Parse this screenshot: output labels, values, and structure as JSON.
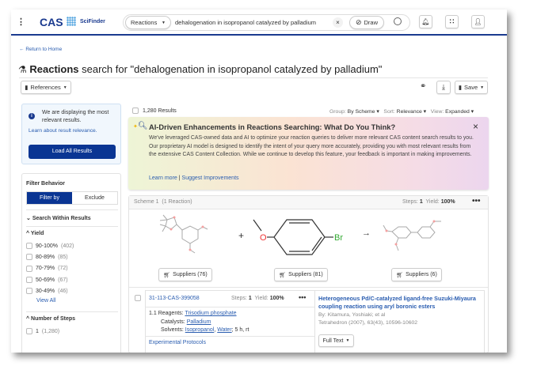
{
  "header": {
    "logo": "CAS",
    "product": "SciFinder",
    "search_type": "Reactions",
    "query": "dehalogenation in isopropanol catalyzed by palladium",
    "draw_label": "Draw"
  },
  "nav": {
    "return_label": "Return to Home"
  },
  "title": {
    "prefix": "Reactions",
    "rest": " search for \"dehalogenation in isopropanol catalyzed by palladium\""
  },
  "toolbar": {
    "references_label": "References",
    "save_label": "Save"
  },
  "info": {
    "message": "We are displaying the most relevant results.",
    "learn_link": "Learn about result relevance.",
    "load_all_label": "Load All Results"
  },
  "filters": {
    "behavior_title": "Filter Behavior",
    "filter_by": "Filter by",
    "exclude": "Exclude",
    "search_within": "Search Within Results",
    "yield_title": "Yield",
    "yield_options": [
      {
        "label": "90-100%",
        "count": "(402)"
      },
      {
        "label": "80-89%",
        "count": "(85)"
      },
      {
        "label": "70-79%",
        "count": "(72)"
      },
      {
        "label": "50-69%",
        "count": "(67)"
      },
      {
        "label": "30-49%",
        "count": "(46)"
      }
    ],
    "view_all": "View All",
    "steps_title": "Number of Steps",
    "steps_options": [
      {
        "label": "1",
        "count": "(1,280)"
      }
    ]
  },
  "results": {
    "count": "1,280 Results",
    "group_label": "Group:",
    "group_value": "By Scheme",
    "sort_label": "Sort:",
    "sort_value": "Relevance",
    "view_label": "View:",
    "view_value": "Expanded"
  },
  "banner": {
    "title": "AI-Driven Enhancements in Reactions Searching: What Do You Think?",
    "body": "We've leveraged CAS-owned data and AI to optimize your reaction queries to deliver more relevant CAS content search results to you. Our proprietary AI model is designed to identify the intent of your query more accurately, providing you with most relevant results from the extensive CAS Content Collection. While we continue to develop this feature, your feedback is important in making improvements.",
    "learn_more": "Learn more",
    "sep": "|",
    "suggest": "Suggest Improvements"
  },
  "scheme": {
    "label": "Scheme 1",
    "reactions": "(1 Reaction)",
    "steps_label": "Steps:",
    "steps": "1",
    "yield_label": "Yield:",
    "yield": "100%",
    "plus": "+",
    "arrow": "→",
    "br": "Br",
    "o": "O",
    "suppliers": [
      "Suppliers (76)",
      "Suppliers (81)",
      "Suppliers (6)"
    ]
  },
  "reaction": {
    "id": "31-113-CAS-399058",
    "steps_label": "Steps:",
    "steps": "1",
    "yield_label": "Yield:",
    "yield": "100%",
    "step_no": "1.1",
    "reagents_label": "Reagents:",
    "reagent": "Trisodium phosphate",
    "catalysts_label": "Catalysts:",
    "catalyst": "Palladium",
    "solvents_label": "Solvents:",
    "solvent1": "Isopropanol",
    "solvent2": "Water",
    "conditions": "; 5 h, rt",
    "protocols": "Experimental Protocols",
    "ref_title": "Heterogeneous Pd/C-catalyzed ligand-free Suzuki-Miyaura coupling reaction using aryl boronic esters",
    "authors": "By: Kitamura, Yoshiaki; et al",
    "journal": "Tetrahedron (2007), 63(43), 10596-10602",
    "full_text": "Full Text"
  },
  "colors": {
    "brand": "#1a3a8f",
    "link": "#2a5db0"
  }
}
